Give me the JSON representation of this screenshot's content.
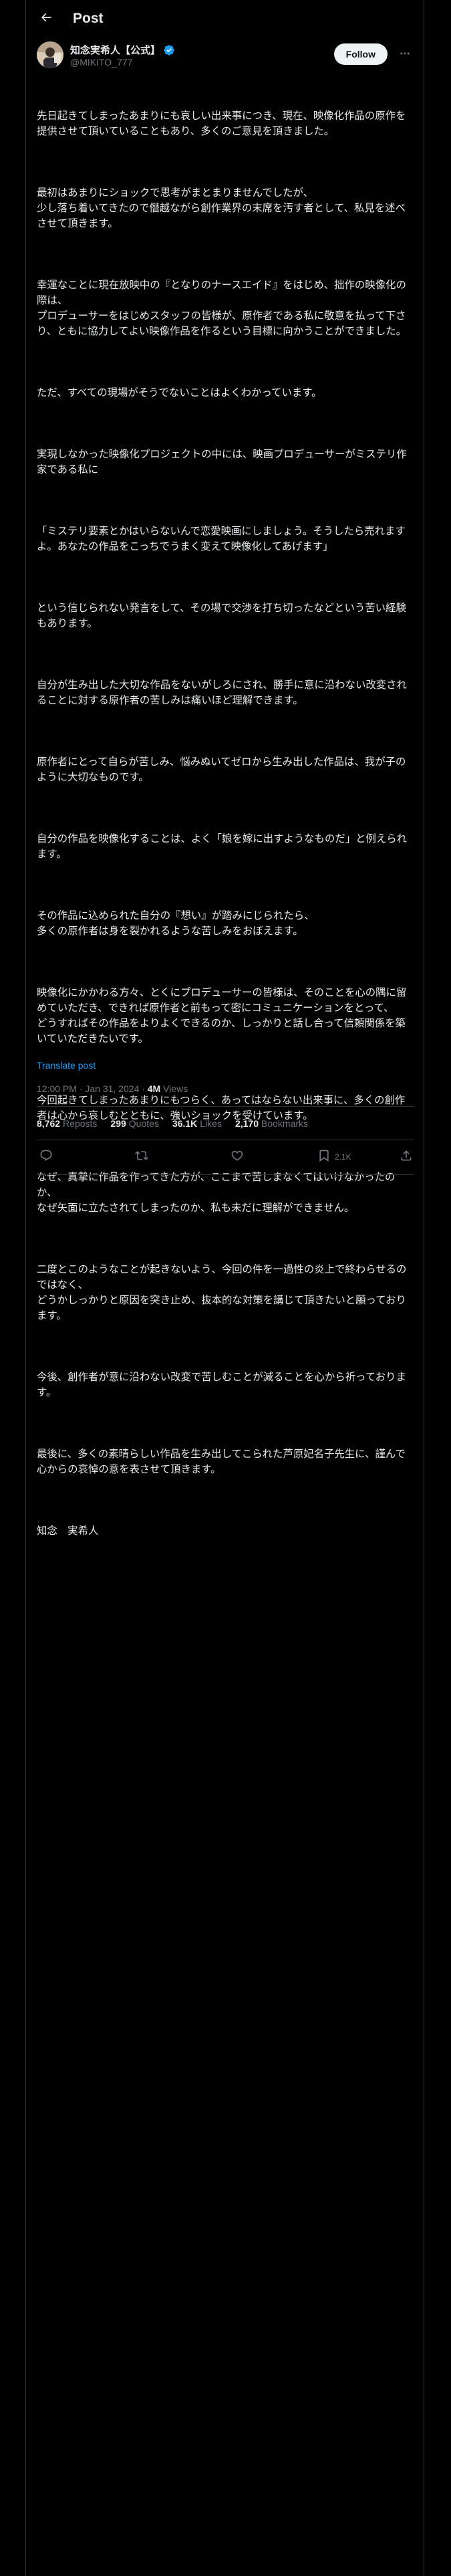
{
  "header": {
    "title": "Post",
    "back_icon": "back-arrow-icon"
  },
  "author": {
    "name": "知念実希人【公式】",
    "handle": "@MIKITO_777",
    "verified": true,
    "follow_label": "Follow",
    "more_icon": "more-dots-icon"
  },
  "tweet": {
    "paragraphs": [
      "先日起きてしまったあまりにも哀しい出来事につき、現在、映像化作品の原作を提供させて頂いていることもあり、多くのご意見を頂きました。",
      "最初はあまりにショックで思考がまとまりませんでしたが、\n少し落ち着いてきたので僭越ながら創作業界の末席を汚す者として、私見を述べさせて頂きます。",
      "幸運なことに現在放映中の『となりのナースエイド』をはじめ、拙作の映像化の際は、\nプロデューサーをはじめスタッフの皆様が、原作者である私に敬意を払って下さり、ともに協力してよい映像作品を作るという目標に向かうことができました。",
      "ただ、すべての現場がそうでないことはよくわかっています。",
      "実現しなかった映像化プロジェクトの中には、映画プロデューサーがミステリ作家である私に",
      "「ミステリ要素とかはいらないんで恋愛映画にしましょう。そうしたら売れますよ。あなたの作品をこっちでうまく変えて映像化してあげます」",
      "という信じられない発言をして、その場で交渉を打ち切ったなどという苦い経験もあります。",
      "自分が生み出した大切な作品をないがしろにされ、勝手に意に沿わない改変されることに対する原作者の苦しみは痛いほど理解できます。",
      "原作者にとって自らが苦しみ、悩みぬいてゼロから生み出した作品は、我が子のように大切なものです。",
      "自分の作品を映像化することは、よく「娘を嫁に出すようなものだ」と例えられます。",
      "その作品に込められた自分の『想い』が踏みにじられたら、\n多くの原作者は身を裂かれるような苦しみをおぼえます。",
      "映像化にかかわる方々、とくにプロデューサーの皆様は、そのことを心の隅に留めていただき、できれば原作者と前もって密にコミュニケーションをとって、\nどうすればその作品をよりよくできるのか、しっかりと話し合って信頼関係を築いていただきたいです。",
      "今回起きてしまったあまりにもつらく、あってはならない出来事に、多くの創作者は心から哀しむとともに、強いショックを受けています。",
      "なぜ、真摯に作品を作ってきた方が、ここまで苦しまなくてはいけなかったのか、\nなぜ矢面に立たされてしまったのか、私も未だに理解ができません。",
      "二度とこのようなことが起きないよう、今回の件を一過性の炎上で終わらせるのではなく、\nどうかしっかりと原因を突き止め、抜本的な対策を講じて頂きたいと願っております。",
      "今後、創作者が意に沿わない改変で苦しむことが減ることを心から祈っております。",
      "最後に、多くの素晴らしい作品を生み出してこられた芦原妃名子先生に、謹んで心からの哀悼の意を表させて頂きます。"
    ],
    "signature": "知念　実希人",
    "translate_label": "Translate post",
    "time": "12:00 PM · Jan 31, 2024 · ",
    "views_count": "4M",
    "views_label": " Views"
  },
  "stats": {
    "reposts_count": "8,762",
    "reposts_label": "Reposts",
    "quotes_count": "299",
    "quotes_label": "Quotes",
    "likes_count": "36.1K",
    "likes_label": "Likes",
    "bookmarks_count": "2,170",
    "bookmarks_label": "Bookmarks"
  },
  "actions": {
    "reply_icon": "reply-icon",
    "repost_icon": "repost-icon",
    "like_icon": "heart-icon",
    "bookmark_icon": "bookmark-icon",
    "bookmark_count": "2.1K",
    "share_icon": "share-icon"
  },
  "colors": {
    "background": "#000000",
    "text": "#e7e9ea",
    "muted": "#71767b",
    "accent": "#1d9bf0",
    "border": "#2f3336"
  }
}
